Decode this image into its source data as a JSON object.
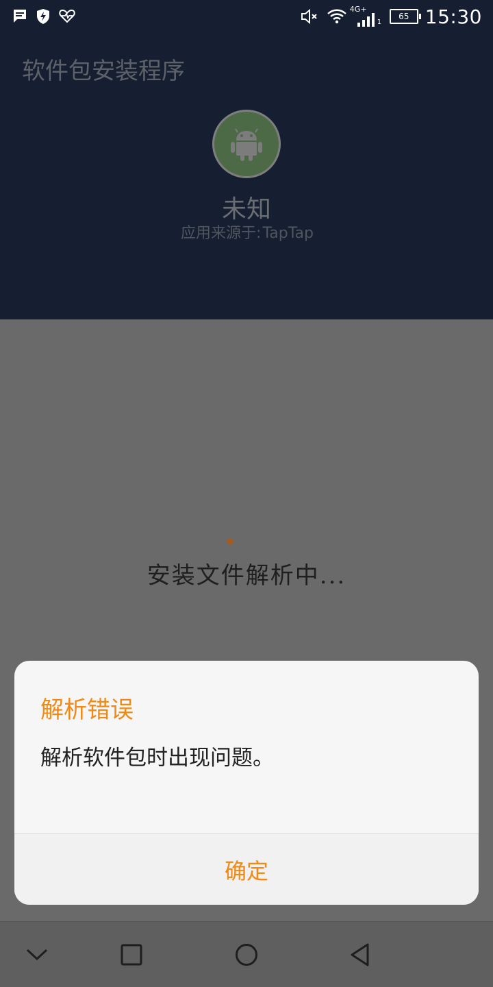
{
  "status_bar": {
    "time": "15:30",
    "battery": "65",
    "network": "4G+",
    "sim_slot": "1",
    "left_icons": [
      "message-icon",
      "shield-bolt-icon",
      "heart-pulse-icon"
    ],
    "right_icons": [
      "mute-icon",
      "wifi-icon",
      "signal-icon",
      "battery-icon"
    ]
  },
  "header": {
    "title": "软件包安装程序",
    "app_name": "未知",
    "source_label": "应用来源于:",
    "source_value": "TapTap",
    "app_icon": "android-icon"
  },
  "body": {
    "status_text": "安装文件解析中..."
  },
  "dialog": {
    "title": "解析错误",
    "message": "解析软件包时出现问题。",
    "confirm_label": "确定"
  },
  "nav_bar": {
    "icons": [
      "chevron-down-icon",
      "recents-icon",
      "home-icon",
      "back-icon"
    ]
  },
  "colors": {
    "accent": "#f08a16",
    "header_bg": "#161f31",
    "scrim": "#6a6a6a",
    "dialog_bg": "#f6f6f6"
  }
}
